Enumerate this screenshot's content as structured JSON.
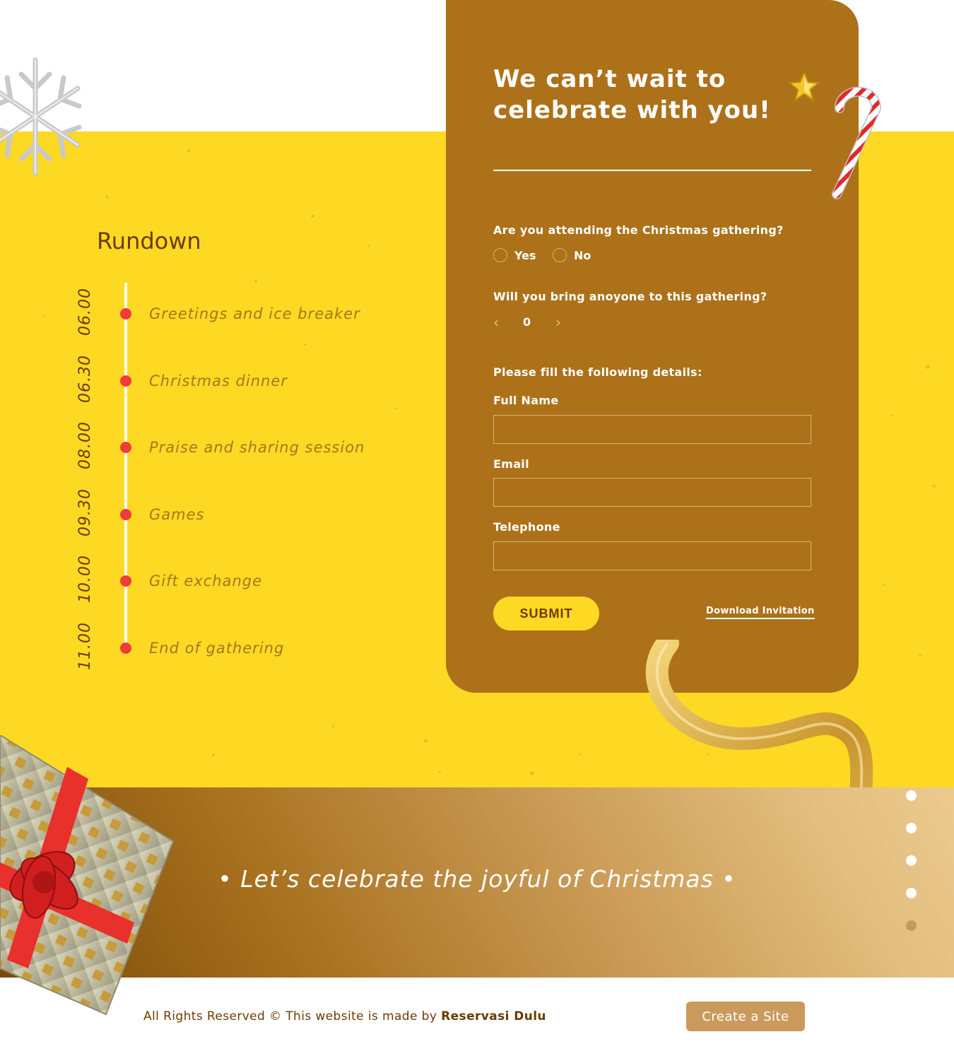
{
  "card": {
    "title": "We can’t wait to celebrate with you!",
    "q_attend": "Are you attending the Christmas gathering?",
    "opt_yes": "Yes",
    "opt_no": "No",
    "q_bring": "Will you bring anoyone to this gathering?",
    "guest_count": "0",
    "q_details": "Please fill the following details:",
    "full_name_label": "Full Name",
    "email_label": "Email",
    "telephone_label": "Telephone",
    "submit_label": "SUBMIT",
    "download_label": "Download Invitation"
  },
  "rundown": {
    "title": "Rundown",
    "items": [
      {
        "time": "06.00",
        "label": "Greetings and ice breaker"
      },
      {
        "time": "06.30",
        "label": "Christmas dinner"
      },
      {
        "time": "08.00",
        "label": "Praise and sharing session"
      },
      {
        "time": "09.30",
        "label": "Games"
      },
      {
        "time": "10.00",
        "label": "Gift exchange"
      },
      {
        "time": "11.00",
        "label": "End of gathering"
      }
    ]
  },
  "banner": {
    "tagline": "• Let’s celebrate the joyful of Christmas •",
    "slides_total": 5,
    "active_slide": 4
  },
  "footer": {
    "text": "All Rights Reserved © This website is made by",
    "brand": "Reservasi Dulu",
    "create_site_label": "Create a Site"
  },
  "colors": {
    "yellow": "#fdd923",
    "card_brown": "#ad711a",
    "dark_brown": "#6b3a00",
    "timeline_dot": "#f03b3b"
  }
}
